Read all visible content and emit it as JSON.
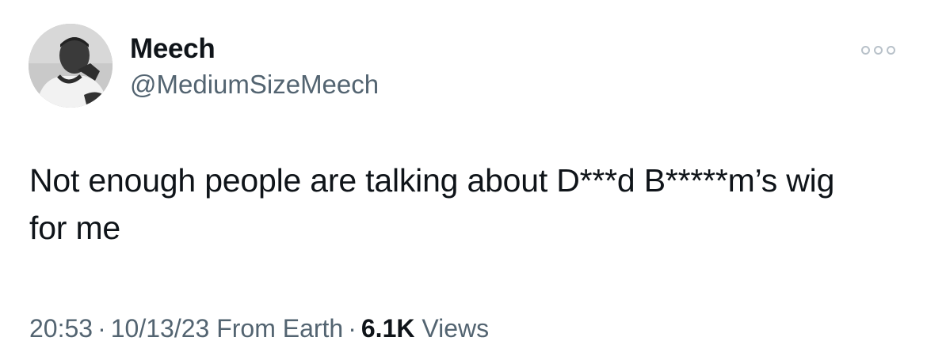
{
  "author": {
    "display_name": "Meech",
    "handle": "@MediumSizeMeech",
    "avatar_icon": "profile-photo-icon"
  },
  "more_button": {
    "icon": "more-dots-icon"
  },
  "tweet": {
    "text": "Not enough people are talking about D***d B*****m’s wig\nfor me"
  },
  "meta": {
    "time": "20:53",
    "separator": "·",
    "date": "10/13/23",
    "source": "From Earth",
    "views_count": "6.1K",
    "views_label": "Views"
  }
}
